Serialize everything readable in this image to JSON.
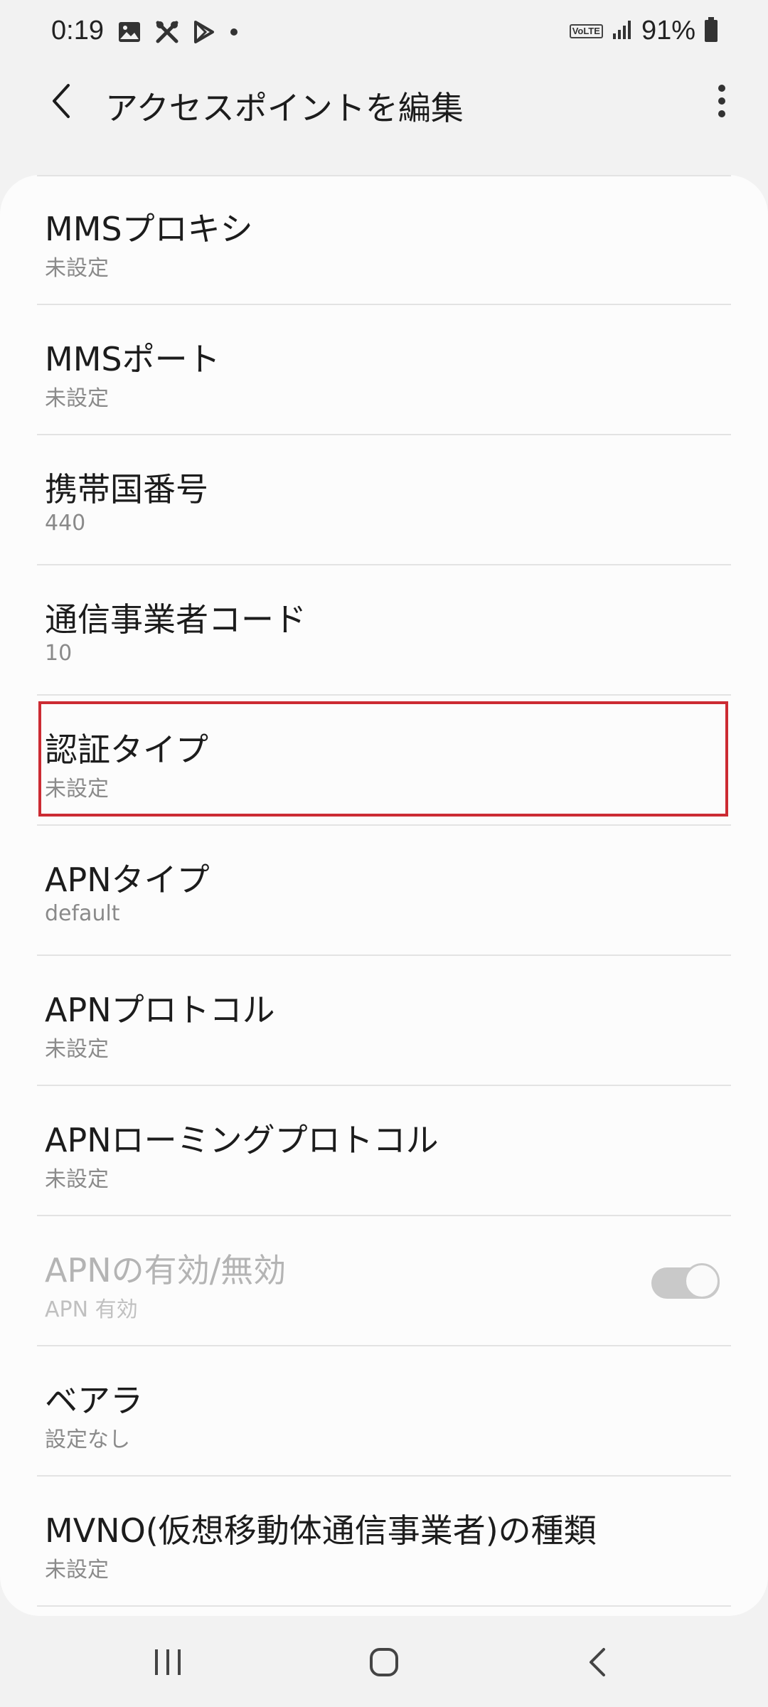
{
  "status_bar": {
    "time": "0:19",
    "volte": "VoLTE",
    "battery_percent": "91%",
    "icons_left": [
      "gallery-icon",
      "tools-icon",
      "play-store-icon",
      "dot-icon"
    ],
    "icons_right": [
      "volte-icon",
      "signal-icon",
      "battery-icon"
    ]
  },
  "app_bar": {
    "title": "アクセスポイントを編集",
    "back_icon": "chevron-left-icon",
    "more_icon": "more-vert-icon"
  },
  "settings": [
    {
      "title": "MMSプロキシ",
      "value": "未設定"
    },
    {
      "title": "MMSポート",
      "value": "未設定"
    },
    {
      "title": "携帯国番号",
      "value": "440"
    },
    {
      "title": "通信事業者コード",
      "value": "10"
    },
    {
      "title": "認証タイプ",
      "value": "未設定",
      "highlighted": true
    },
    {
      "title": "APNタイプ",
      "value": "default"
    },
    {
      "title": "APNプロトコル",
      "value": "未設定"
    },
    {
      "title": "APNローミングプロトコル",
      "value": "未設定"
    },
    {
      "title": "APNの有効/無効",
      "value": "APN 有効",
      "disabled": true,
      "toggle_on": true
    },
    {
      "title": "ベアラ",
      "value": "設定なし"
    },
    {
      "title": "MVNO(仮想移動体通信事業者)の種類",
      "value": "未設定"
    }
  ],
  "nav_bar": {
    "recents_icon": "recents-icon",
    "home_icon": "home-icon",
    "back_icon": "back-icon"
  },
  "colors": {
    "highlight": "#cc2b33",
    "background": "#f2f2f2",
    "card": "#fcfcfc"
  }
}
